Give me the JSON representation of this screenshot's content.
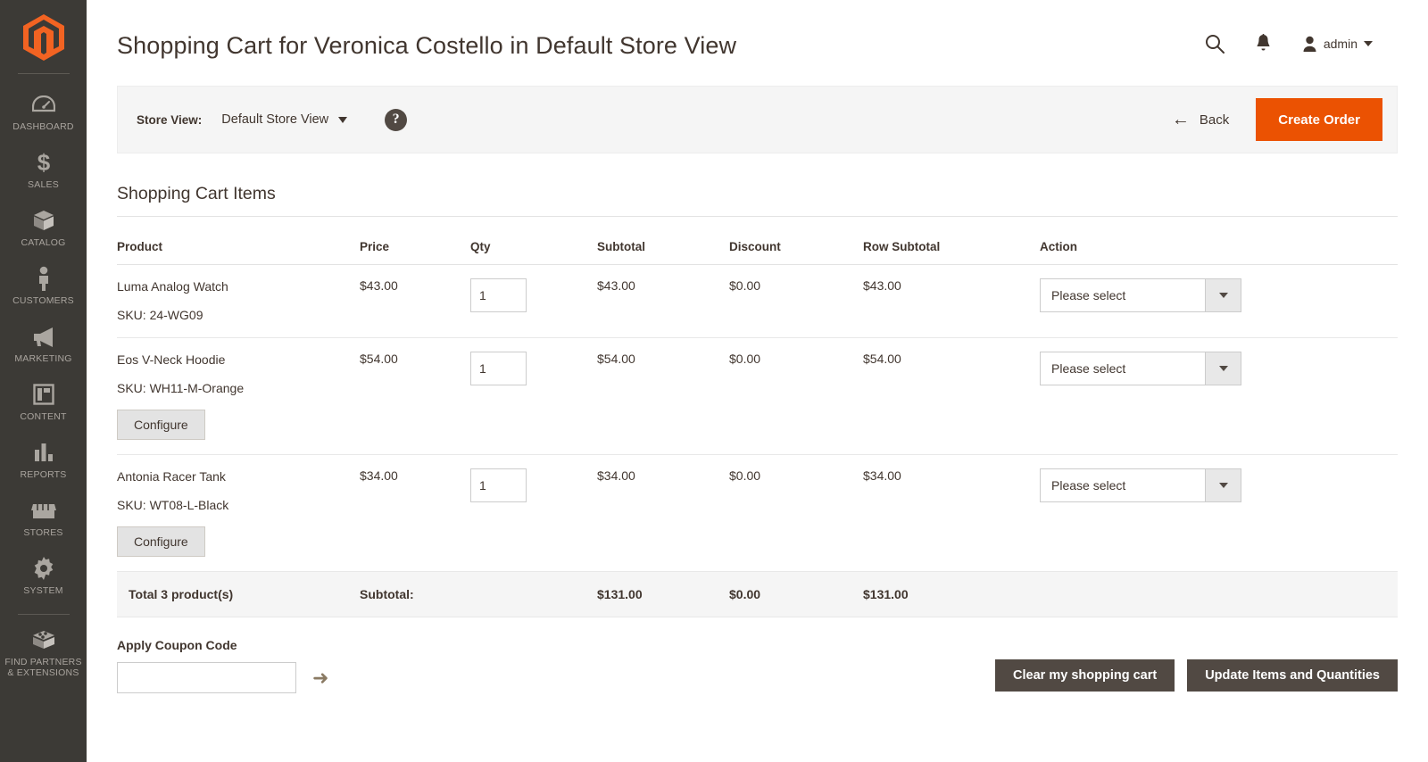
{
  "sidebar": {
    "logo_name": "magento-logo",
    "items": [
      {
        "label": "DASHBOARD",
        "icon": "dashboard-icon"
      },
      {
        "label": "SALES",
        "icon": "dollar-icon"
      },
      {
        "label": "CATALOG",
        "icon": "box-icon"
      },
      {
        "label": "CUSTOMERS",
        "icon": "person-icon"
      },
      {
        "label": "MARKETING",
        "icon": "megaphone-icon"
      },
      {
        "label": "CONTENT",
        "icon": "layout-icon"
      },
      {
        "label": "REPORTS",
        "icon": "bar-chart-icon"
      },
      {
        "label": "STORES",
        "icon": "storefront-icon"
      },
      {
        "label": "SYSTEM",
        "icon": "gear-icon"
      },
      {
        "label": "FIND PARTNERS\n& EXTENSIONS",
        "icon": "extensions-icon"
      }
    ]
  },
  "header": {
    "title": "Shopping Cart for Veronica Costello in Default Store View",
    "search_icon": "search-icon",
    "notifications_icon": "bell-icon",
    "admin_label": "admin"
  },
  "toolbar": {
    "store_view_label": "Store View:",
    "store_view_value": "Default Store View",
    "help_icon_label": "?",
    "back_label": "Back",
    "create_order_label": "Create Order",
    "accent_color": "#eb5202"
  },
  "section": {
    "title": "Shopping Cart Items"
  },
  "table": {
    "columns": [
      "Product",
      "Price",
      "Qty",
      "Subtotal",
      "Discount",
      "Row Subtotal",
      "Action"
    ],
    "rows": [
      {
        "product": "Luma Analog Watch",
        "sku": "SKU: 24-WG09",
        "configure_label": null,
        "price": "$43.00",
        "qty": "1",
        "subtotal": "$43.00",
        "discount": "$0.00",
        "row_subtotal": "$43.00",
        "action": "Please select"
      },
      {
        "product": "Eos V-Neck Hoodie",
        "sku": "SKU: WH11-M-Orange",
        "configure_label": "Configure",
        "price": "$54.00",
        "qty": "1",
        "subtotal": "$54.00",
        "discount": "$0.00",
        "row_subtotal": "$54.00",
        "action": "Please select"
      },
      {
        "product": "Antonia Racer Tank",
        "sku": "SKU: WT08-L-Black",
        "configure_label": "Configure",
        "price": "$34.00",
        "qty": "1",
        "subtotal": "$34.00",
        "discount": "$0.00",
        "row_subtotal": "$34.00",
        "action": "Please select"
      }
    ],
    "totals": {
      "count_label": "Total 3 product(s)",
      "subtotal_label": "Subtotal:",
      "subtotal": "$131.00",
      "discount": "$0.00",
      "row_subtotal": "$131.00"
    }
  },
  "footer": {
    "coupon_label": "Apply Coupon Code",
    "coupon_value": "",
    "coupon_placeholder": "",
    "coupon_submit_icon": "arrow-right-icon",
    "clear_cart_label": "Clear my shopping cart",
    "update_items_label": "Update Items and Quantities"
  }
}
